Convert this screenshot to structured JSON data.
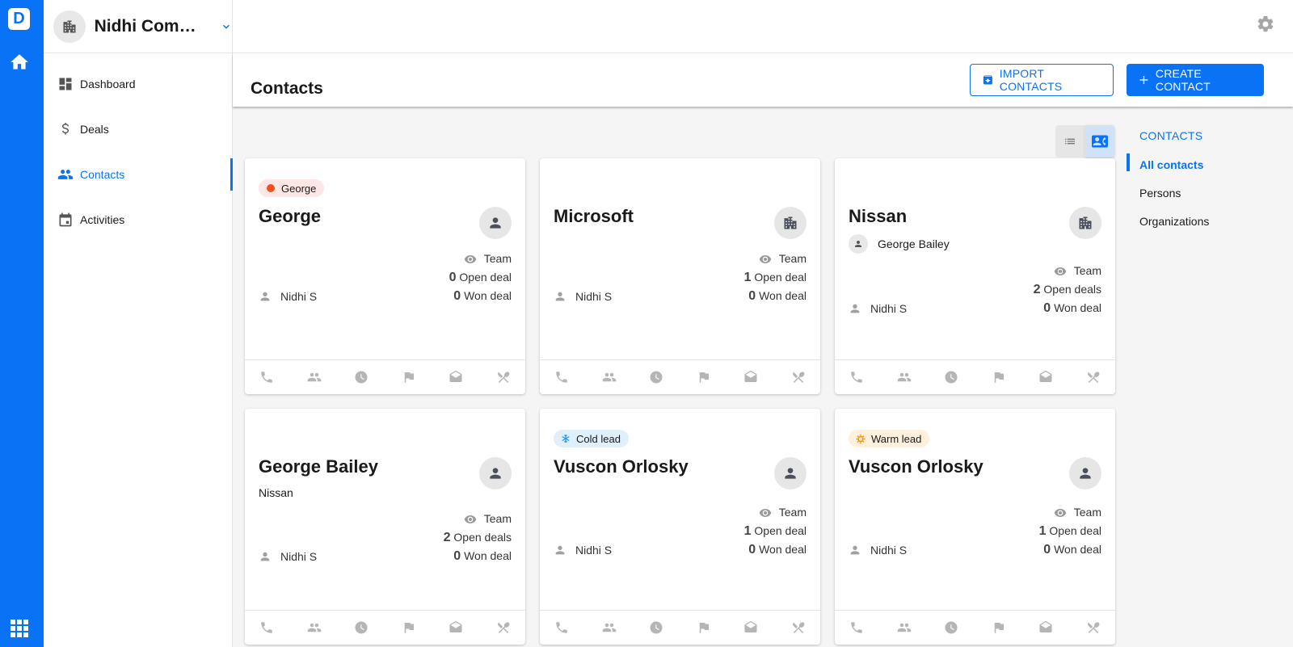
{
  "app": {
    "logo_letter": "D"
  },
  "org": {
    "name": "Nidhi Company"
  },
  "nav": [
    {
      "label": "Dashboard",
      "icon": "dashboard-icon",
      "active": false
    },
    {
      "label": "Deals",
      "icon": "dollar-icon",
      "active": false
    },
    {
      "label": "Contacts",
      "icon": "people-icon",
      "active": true
    },
    {
      "label": "Activities",
      "icon": "calendar-icon",
      "active": false
    }
  ],
  "header": {
    "title": "Contacts",
    "import_label": "IMPORT CONTACTS",
    "create_label": "CREATE CONTACT"
  },
  "colors": {
    "accent": "#0a72f5",
    "tag_red": "#f4511e",
    "tag_cold": "#2196f3",
    "tag_warm": "#fb8c00"
  },
  "filters": {
    "title": "CONTACTS",
    "items": [
      {
        "label": "All contacts",
        "active": true
      },
      {
        "label": "Persons",
        "active": false
      },
      {
        "label": "Organizations",
        "active": false
      }
    ]
  },
  "cards": [
    {
      "tag": "George",
      "tag_type": "red",
      "name": "George",
      "type": "person",
      "subtitle": "",
      "linked": "",
      "visibility": "Team",
      "open_count": "0",
      "open_label": "Open deal",
      "won_count": "0",
      "won_label": "Won deal",
      "owner": "Nidhi S"
    },
    {
      "tag": "",
      "tag_type": "",
      "name": "Microsoft",
      "type": "organization",
      "subtitle": "",
      "linked": "",
      "visibility": "Team",
      "open_count": "1",
      "open_label": "Open deal",
      "won_count": "0",
      "won_label": "Won deal",
      "owner": "Nidhi S"
    },
    {
      "tag": "",
      "tag_type": "",
      "name": "Nissan",
      "type": "organization",
      "subtitle": "",
      "linked": "George Bailey",
      "visibility": "Team",
      "open_count": "2",
      "open_label": "Open deals",
      "won_count": "0",
      "won_label": "Won deal",
      "owner": "Nidhi S"
    },
    {
      "tag": "",
      "tag_type": "",
      "name": "George Bailey",
      "type": "person",
      "subtitle": "Nissan",
      "linked": "",
      "visibility": "Team",
      "open_count": "2",
      "open_label": "Open deals",
      "won_count": "0",
      "won_label": "Won deal",
      "owner": "Nidhi S"
    },
    {
      "tag": "Cold lead",
      "tag_type": "blue",
      "name": "Vuscon Orlosky",
      "type": "person",
      "subtitle": "",
      "linked": "",
      "visibility": "Team",
      "open_count": "1",
      "open_label": "Open deal",
      "won_count": "0",
      "won_label": "Won deal",
      "owner": "Nidhi S"
    },
    {
      "tag": "Warm lead",
      "tag_type": "orange",
      "name": "Vuscon Orlosky",
      "type": "person",
      "subtitle": "",
      "linked": "",
      "visibility": "Team",
      "open_count": "1",
      "open_label": "Open deal",
      "won_count": "0",
      "won_label": "Won deal",
      "owner": "Nidhi S"
    }
  ],
  "card_actions": [
    "call-icon",
    "meeting-icon",
    "task-icon",
    "deadline-icon",
    "email-icon",
    "lunch-icon"
  ]
}
